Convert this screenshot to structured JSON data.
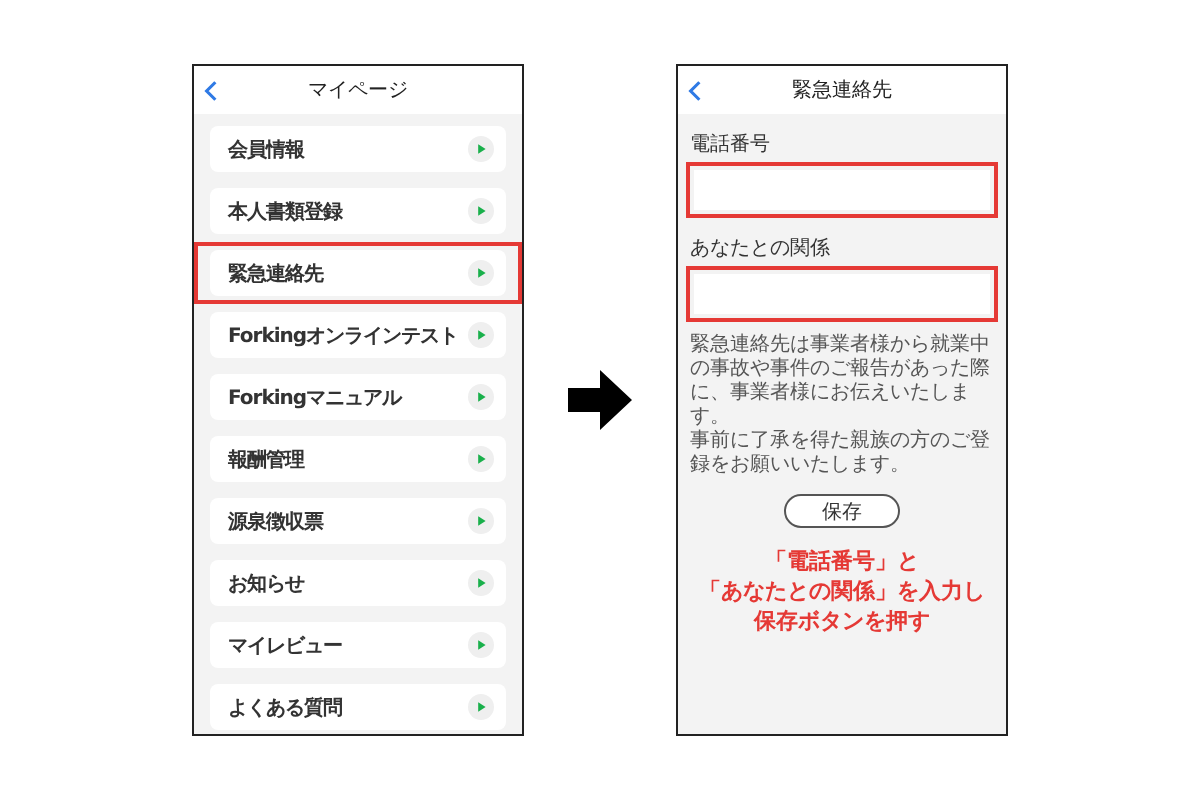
{
  "left_screen": {
    "title": "マイページ",
    "menu_items": [
      {
        "label": "会員情報",
        "highlighted": false
      },
      {
        "label": "本人書類登録",
        "highlighted": false
      },
      {
        "label": "緊急連絡先",
        "highlighted": true
      },
      {
        "label": "Forkingオンラインテスト",
        "highlighted": false
      },
      {
        "label": "Forkingマニュアル",
        "highlighted": false
      },
      {
        "label": "報酬管理",
        "highlighted": false
      },
      {
        "label": "源泉徴収票",
        "highlighted": false
      },
      {
        "label": "お知らせ",
        "highlighted": false
      },
      {
        "label": "マイレビュー",
        "highlighted": false
      },
      {
        "label": "よくある質問",
        "highlighted": false
      }
    ]
  },
  "right_screen": {
    "title": "緊急連絡先",
    "fields": [
      {
        "label": "電話番号",
        "highlighted": true
      },
      {
        "label": "あなたとの関係",
        "highlighted": true
      }
    ],
    "note": [
      "緊急連絡先は事業者様から就業中の事故や事件のご報告があった際に、事業者様にお伝えいたします。",
      "事前に了承を得た親族の方のご登録をお願いいたします。"
    ],
    "save_button": "保存",
    "instruction": [
      "「電話番号」と",
      "「あなたとの関係」を入力し",
      "保存ボタンを押す"
    ]
  }
}
